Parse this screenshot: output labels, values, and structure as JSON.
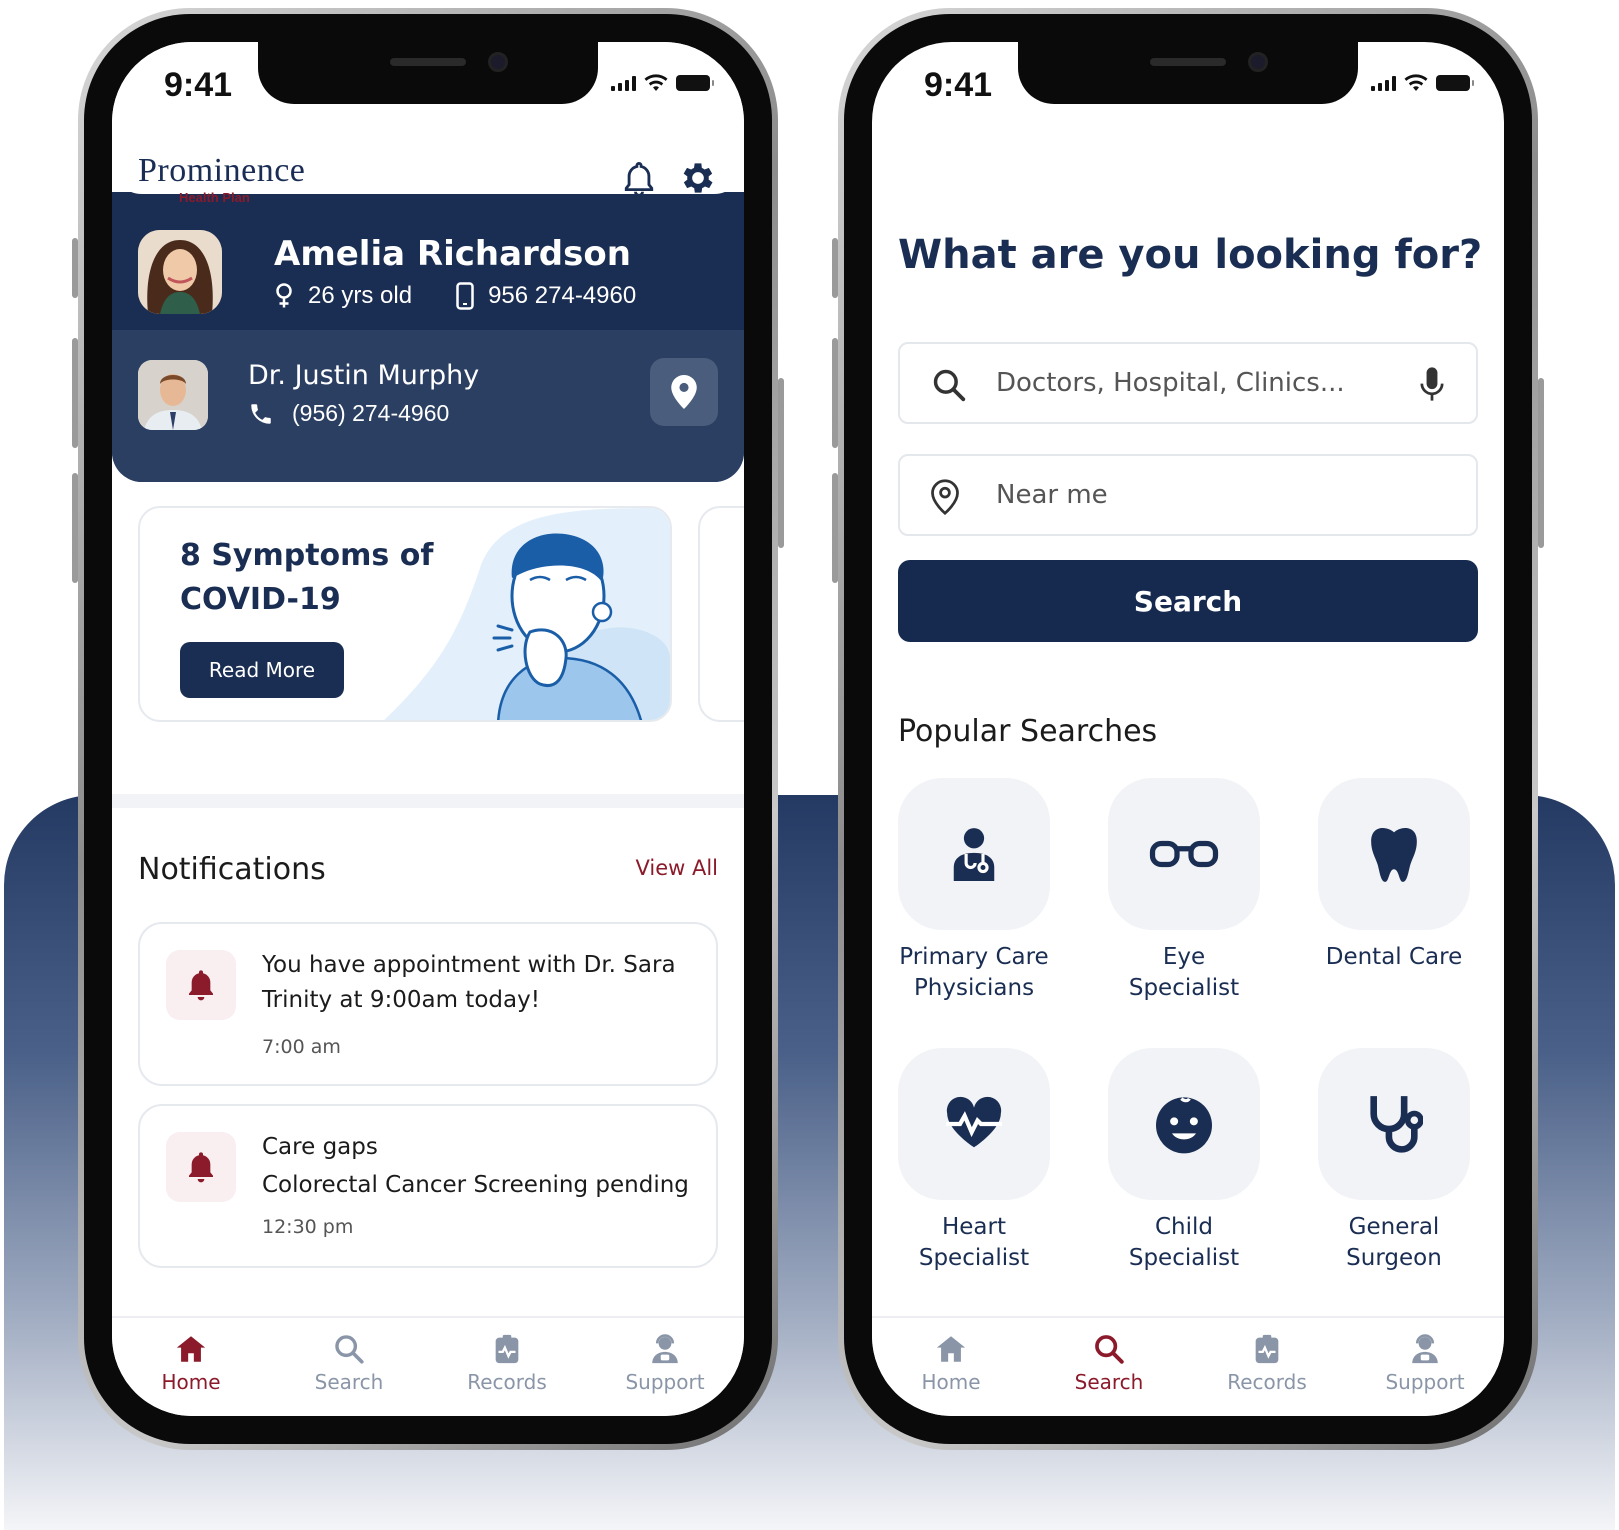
{
  "status": {
    "time": "9:41"
  },
  "home": {
    "brand": {
      "name": "Prominence",
      "sub": "Health Plan"
    },
    "member": {
      "name": "Amelia Richardson",
      "age": "26 yrs old",
      "phone": "956 274-4960"
    },
    "doctor": {
      "name": "Dr. Justin Murphy",
      "phone": "(956) 274-4960"
    },
    "article": {
      "title": "8 Symptoms of COVID-19",
      "button": "Read More"
    },
    "notifications": {
      "heading": "Notifications",
      "view_all": "View All",
      "items": [
        {
          "text": "You have appointment with Dr. Sara Trinity at 9:00am today!",
          "time": "7:00 am"
        },
        {
          "title": "Care gaps",
          "text": "Colorectal Cancer Screening pending",
          "time": "12:30 pm"
        }
      ]
    }
  },
  "search": {
    "heading": "What are you looking for?",
    "query_placeholder": "Doctors, Hospital, Clinics...",
    "location_placeholder": "Near me",
    "button": "Search",
    "popular_title": "Popular Searches",
    "categories": [
      {
        "label": "Primary Care Physicians",
        "icon": "doctor-icon"
      },
      {
        "label": "Eye Specialist",
        "icon": "glasses-icon"
      },
      {
        "label": "Dental Care",
        "icon": "tooth-icon"
      },
      {
        "label": "Heart Specialist",
        "icon": "heartbeat-icon"
      },
      {
        "label": "Child Specialist",
        "icon": "child-face-icon"
      },
      {
        "label": "General Surgeon",
        "icon": "stethoscope-icon"
      }
    ]
  },
  "tabs": [
    {
      "label": "Home",
      "icon": "home-icon"
    },
    {
      "label": "Search",
      "icon": "search-icon"
    },
    {
      "label": "Records",
      "icon": "records-icon"
    },
    {
      "label": "Support",
      "icon": "support-icon"
    }
  ],
  "colors": {
    "navy": "#1a2d52",
    "maroon": "#8b1a2b",
    "tab_inactive": "#8a96a8"
  }
}
